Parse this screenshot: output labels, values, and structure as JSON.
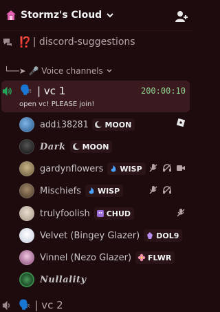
{
  "server": {
    "name": "Stormz's Cloud"
  },
  "channels": {
    "suggestions": {
      "prefix": "⁉️",
      "label": "| discord-suggestions"
    },
    "voice_category": {
      "label": "└──➤ 🎤 Voice channels"
    },
    "vc1": {
      "emoji": "🗣️",
      "name": "| vc 1",
      "timer": "200:00:10",
      "status": "open vc! PLEASE join!"
    },
    "vc2": {
      "emoji": "🗣️",
      "name": "| vc 2"
    }
  },
  "users": [
    {
      "name": "addi38281",
      "tag": "MOON",
      "tag_icon": "moon-icon",
      "right": [
        "roblox-icon"
      ]
    },
    {
      "name": "Dark",
      "tag": "MOON",
      "tag_icon": "moon-icon",
      "right": []
    },
    {
      "name": "gardynflowers",
      "tag": "WISP",
      "tag_icon": "fire-icon",
      "right": [
        "mute-icon",
        "deafen-icon",
        "camera-icon"
      ]
    },
    {
      "name": "Mischiefs",
      "tag": "WISP",
      "tag_icon": "fire-icon",
      "right": [
        "mute-icon",
        "deafen-icon"
      ]
    },
    {
      "name": "trulyfoolish",
      "tag": "CHUD",
      "tag_icon": "purple-face-icon",
      "right": [
        "mute-icon"
      ]
    },
    {
      "name": "Velvet (Bingey Glazer)",
      "tag": "DOL9",
      "tag_icon": "gem-icon",
      "right": []
    },
    {
      "name": "Vinnel (Nezo Glazer)",
      "tag": "FLWR",
      "tag_icon": "flower-icon",
      "right": []
    },
    {
      "name": "Nullality",
      "tag": "",
      "tag_icon": "",
      "right": []
    }
  ],
  "colors": {
    "background": "#1e0b0e",
    "selected_channel": "#3b1a1f",
    "timer": "#8fd18f",
    "speaker_green": "#23a55a"
  }
}
